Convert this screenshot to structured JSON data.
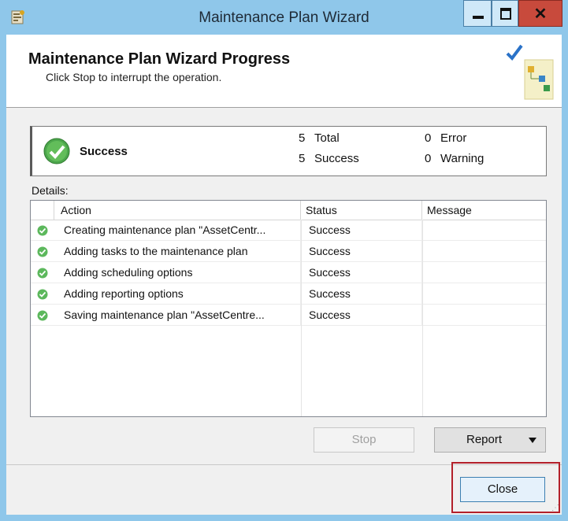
{
  "window": {
    "title": "Maintenance Plan Wizard"
  },
  "header": {
    "title": "Maintenance Plan Wizard Progress",
    "subtitle": "Click Stop to interrupt the operation."
  },
  "summary": {
    "status": "Success",
    "total_count": "5",
    "total_label": "Total",
    "success_count": "5",
    "success_label": "Success",
    "error_count": "0",
    "error_label": "Error",
    "warning_count": "0",
    "warning_label": "Warning"
  },
  "details": {
    "label": "Details:",
    "columns": {
      "action": "Action",
      "status": "Status",
      "message": "Message"
    },
    "rows": [
      {
        "action": "Creating maintenance plan \"AssetCentr...",
        "status": "Success",
        "message": ""
      },
      {
        "action": "Adding tasks to the maintenance plan",
        "status": "Success",
        "message": ""
      },
      {
        "action": "Adding scheduling options",
        "status": "Success",
        "message": ""
      },
      {
        "action": "Adding reporting options",
        "status": "Success",
        "message": ""
      },
      {
        "action": "Saving maintenance plan \"AssetCentre...",
        "status": "Success",
        "message": ""
      }
    ]
  },
  "buttons": {
    "stop": "Stop",
    "report": "Report",
    "close": "Close"
  },
  "colors": {
    "titlebar": "#8fc7ea",
    "success_green": "#5cb85c",
    "highlight_red": "#b3202a"
  },
  "icons": [
    "app-icon",
    "minimize-icon",
    "maximize-icon",
    "close-icon",
    "wizard-illustration",
    "success-check-icon",
    "dropdown-arrow-icon"
  ]
}
